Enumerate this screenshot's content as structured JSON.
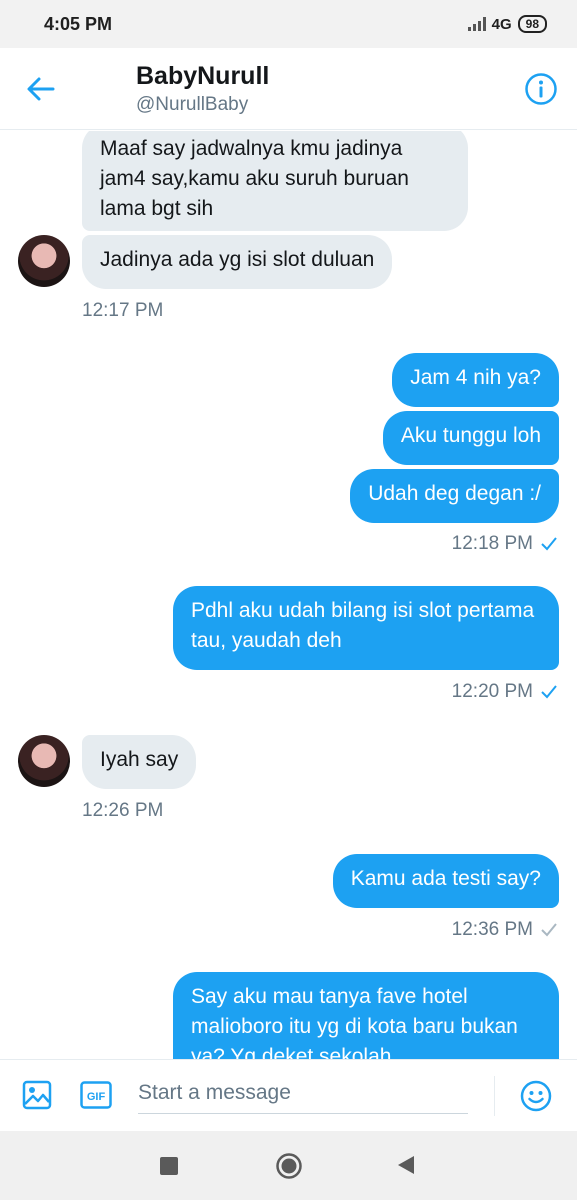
{
  "status": {
    "time": "4:05 PM",
    "network": "4G",
    "battery": "98"
  },
  "header": {
    "name": "BabyNurull",
    "handle": "@NurullBaby"
  },
  "messages": {
    "m1": "Maaf say jadwalnya kmu jadinya jam4 say,kamu aku suruh buruan lama bgt sih",
    "m2": "Jadinya ada yg isi slot duluan",
    "t1": "12:17 PM",
    "m3": "Jam 4 nih ya?",
    "m4": "Aku tunggu loh",
    "m5": "Udah deg degan :/",
    "t2": "12:18 PM",
    "m6": "Pdhl aku udah bilang isi slot pertama tau, yaudah deh",
    "t3": "12:20 PM",
    "m7": "Iyah say",
    "t4": "12:26 PM",
    "m8": "Kamu ada testi say?",
    "t5": "12:36 PM",
    "m9": "Say aku mau tanya fave hotel malioboro itu yg di kota baru bukan ya? Yg deket sekolah"
  },
  "composer": {
    "placeholder": "Start a message",
    "gif_label": "GIF"
  },
  "colors": {
    "accent": "#1da1f2",
    "incoming": "#e6ecf0",
    "muted": "#657786"
  },
  "icons": [
    "back-arrow-icon",
    "info-icon",
    "image-icon",
    "gif-icon",
    "emoji-icon",
    "check-icon",
    "recent-apps-icon",
    "home-icon",
    "back-triangle-icon"
  ]
}
